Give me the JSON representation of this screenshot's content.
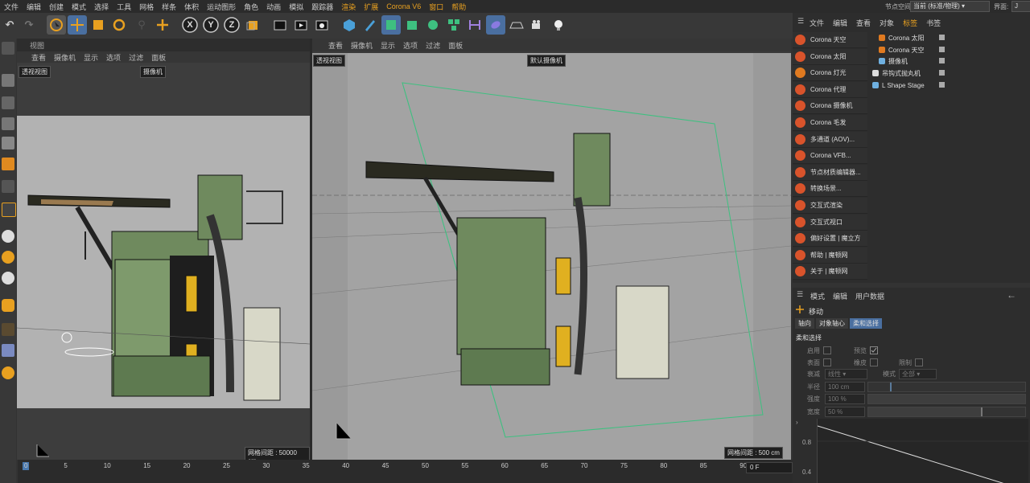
{
  "menubar": {
    "items": [
      "文件",
      "编辑",
      "创建",
      "模式",
      "选择",
      "工具",
      "网格",
      "样条",
      "体积",
      "运动图形",
      "角色",
      "动画",
      "模拟",
      "跟踪器",
      "渲染",
      "扩展",
      "Corona V6",
      "窗口",
      "帮助"
    ]
  },
  "topbar": {
    "node_space_label": "节点空间:",
    "node_space_value": "当前 (标准/物理)",
    "interface_label": "界面:",
    "interface_value": "J"
  },
  "toolbar": {
    "axis_x": "X",
    "axis_y": "Y",
    "axis_z": "Z"
  },
  "viewport_left": {
    "title": "视图",
    "menu": [
      "查看",
      "摄像机",
      "显示",
      "选项",
      "过滤",
      "面板"
    ],
    "view_label": "透视视图",
    "camera_label": "摄像机",
    "grid_label": "网格间距 : 50000 cm"
  },
  "viewport_right": {
    "menu": [
      "查看",
      "摄像机",
      "显示",
      "选项",
      "过滤",
      "面板"
    ],
    "view_label": "透视视图",
    "camera_label": "默认摄像机",
    "grid_label": "网格间距 : 500 cm"
  },
  "right_menu": {
    "items": [
      {
        "label": "Corona 天空",
        "color": "#d9532b"
      },
      {
        "label": "Corona 太阳",
        "color": "#d9532b"
      },
      {
        "label": "Corona 灯光",
        "color": "#e07a20"
      },
      {
        "label": "Corona 代理",
        "color": "#d9532b"
      },
      {
        "label": "Corona 摄像机",
        "color": "#d9532b"
      },
      {
        "label": "Corona 毛发",
        "color": "#d9532b"
      },
      {
        "label": "多通道 (AOV)...",
        "color": "#d9532b"
      },
      {
        "label": "Corona VFB...",
        "color": "#d9532b"
      },
      {
        "label": "节点材质编辑器...",
        "color": "#d9532b"
      },
      {
        "label": "转换场景...",
        "color": "#d9532b"
      },
      {
        "label": "交互式渲染",
        "color": "#d9532b"
      },
      {
        "label": "交互式视口",
        "color": "#d9532b"
      },
      {
        "label": "偏好设置 | 魔立方",
        "color": "#d9532b"
      },
      {
        "label": "帮助 | 魔顿网",
        "color": "#d9532b"
      },
      {
        "label": "关于 | 魔顿网",
        "color": "#d9532b"
      }
    ]
  },
  "object_manager": {
    "menu": [
      "文件",
      "编辑",
      "查看",
      "对象",
      "标签",
      "书签"
    ],
    "objects": [
      {
        "name": "Corona 太阳"
      },
      {
        "name": "Corona 天空"
      },
      {
        "name": "摄像机"
      },
      {
        "name": "吊钩式抛丸机"
      },
      {
        "name": "L Shape Stage"
      }
    ]
  },
  "attributes": {
    "menu": [
      "模式",
      "编辑",
      "用户数据"
    ],
    "tool_name": "移动",
    "tabs": [
      "轴向",
      "对象轴心",
      "柔和选择"
    ],
    "section": "柔和选择",
    "enable_label": "启用",
    "preview_label": "预览",
    "surface_label": "表面",
    "rubber_label": "橡皮",
    "limit_label": "限制",
    "falloff_label": "衰减",
    "falloff_value": "线性",
    "mode_label": "模式",
    "mode_value": "全部",
    "radius_label": "半径",
    "radius_value": "100 cm",
    "strength_label": "强度",
    "strength_value": "100 %",
    "width_label": "宽度",
    "width_value": "50 %",
    "graph_y1": "0.8",
    "graph_y2": "0.4"
  },
  "timeline": {
    "ticks": [
      "0",
      "5",
      "10",
      "15",
      "20",
      "25",
      "30",
      "35",
      "40",
      "45",
      "50",
      "55",
      "60",
      "65",
      "70",
      "75",
      "80",
      "85",
      "90"
    ],
    "frame": "0 F"
  }
}
